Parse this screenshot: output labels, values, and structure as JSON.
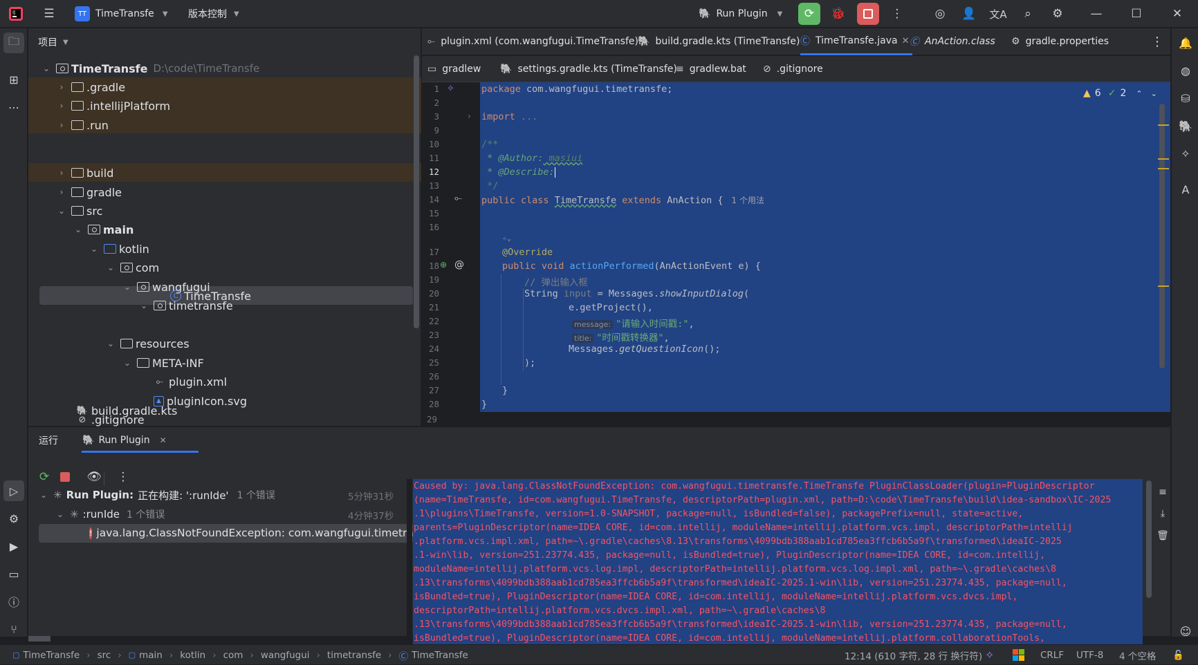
{
  "titlebar": {
    "project_badge": "TT",
    "project_name": "TimeTransfe",
    "vcs": "版本控制",
    "run_config": "Run Plugin"
  },
  "project_panel": {
    "title": "项目",
    "root_name": "TimeTransfe",
    "root_path": "D:\\code\\TimeTransfe",
    "items": [
      ".gradle",
      ".intellijPlatform",
      ".run",
      "build",
      "gradle",
      "src",
      "main",
      "kotlin",
      "com",
      "wangfugui",
      "timetransfe",
      "TimeTransfe",
      "resources",
      "META-INF",
      "plugin.xml",
      "pluginIcon.svg",
      ".gitignore",
      "build.gradle.kts"
    ]
  },
  "editor_tabs": [
    "plugin.xml (com.wangfugui.TimeTransfe)",
    "build.gradle.kts (TimeTransfe)",
    "TimeTransfe.java",
    "AnAction.class",
    "gradle.properties"
  ],
  "editor_tabs_row2": [
    "gradlew",
    "settings.gradle.kts (TimeTransfe)",
    "gradlew.bat",
    ".gitignore"
  ],
  "inspections": {
    "warnings": "6",
    "ok": "2"
  },
  "code": {
    "line_numbers": [
      "1",
      "2",
      "3",
      "9",
      "10",
      "11",
      "12",
      "13",
      "14",
      "15",
      "16",
      "17",
      "18",
      "19",
      "20",
      "21",
      "22",
      "23",
      "24",
      "25",
      "26",
      "27",
      "28",
      "29"
    ],
    "package_kw": "package",
    "package_name": " com.wangfugui.timetransfe;",
    "import_kw": "import",
    "import_rest": " ...",
    "doc_open": "/**",
    "doc_author_tag": " * @Author:",
    "doc_author_val": " masiui",
    "doc_describe_tag": " * @Describe:",
    "doc_close": " */",
    "class_public": "public",
    "class_kw": " class ",
    "class_name": "TimeTransfe",
    "class_extends": " extends ",
    "class_super": "AnAction {",
    "usages_hint": "1 个用法",
    "override": "@Override",
    "method_mod": "public void ",
    "method_name": "actionPerformed",
    "method_params": "(AnActionEvent e) {",
    "comment_line": "// 弹出输入框",
    "string_type": "String ",
    "var_input": "input",
    "assign": " = Messages.",
    "show_dialog": "showInputDialog",
    "open_paren": "(",
    "get_project": "e.getProject(),",
    "hint_message": "message:",
    "str_message": "\"请输入时间戳:\"",
    "hint_title": "title:",
    "str_title": "\"时间戳转换器\"",
    "messages_prefix": "Messages.",
    "question_icon": "getQuestionIcon",
    "close_call": "();",
    "close_paren": ");",
    "brace_inner": "}",
    "brace_outer": "}",
    "comma": ","
  },
  "run_panel": {
    "tab_run": "运行",
    "tab_run_plugin": "Run Plugin",
    "tree": [
      {
        "label": "Run Plugin:",
        "suffix": "正在构建: ':runIde'",
        "errors": "1 个错误",
        "time": "5分钟31秒"
      },
      {
        "label": ":runIde",
        "errors": "1 个错误",
        "time": "4分钟37秒"
      },
      {
        "label": "java.lang.ClassNotFoundException: com.wangfugui.timetran"
      }
    ],
    "console": [
      "Caused by: java.lang.ClassNotFoundException: com.wangfugui.timetransfe.TimeTransfe PluginClassLoader(plugin=PluginDescriptor",
      "(name=TimeTransfe, id=com.wangfugui.TimeTransfe, descriptorPath=plugin.xml, path=D:\\code\\TimeTransfe\\build\\idea-sandbox\\IC-2025",
      ".1\\plugins\\TimeTransfe, version=1.0-SNAPSHOT, package=null, isBundled=false), packagePrefix=null, state=active,",
      "parents=PluginDescriptor(name=IDEA CORE, id=com.intellij, moduleName=intellij.platform.vcs.impl, descriptorPath=intellij",
      ".platform.vcs.impl.xml, path=~\\.gradle\\caches\\8.13\\transforms\\4099bdb388aab1cd785ea3ffcb6b5a9f\\transformed\\ideaIC-2025",
      ".1-win\\lib, version=251.23774.435, package=null, isBundled=true), PluginDescriptor(name=IDEA CORE, id=com.intellij,",
      "moduleName=intellij.platform.vcs.log.impl, descriptorPath=intellij.platform.vcs.log.impl.xml, path=~\\.gradle\\caches\\8",
      ".13\\transforms\\4099bdb388aab1cd785ea3ffcb6b5a9f\\transformed\\ideaIC-2025.1-win\\lib, version=251.23774.435, package=null,",
      "isBundled=true), PluginDescriptor(name=IDEA CORE, id=com.intellij, moduleName=intellij.platform.vcs.dvcs.impl,",
      "descriptorPath=intellij.platform.vcs.dvcs.impl.xml, path=~\\.gradle\\caches\\8",
      ".13\\transforms\\4099bdb388aab1cd785ea3ffcb6b5a9f\\transformed\\ideaIC-2025.1-win\\lib, version=251.23774.435, package=null,",
      "isBundled=true), PluginDescriptor(name=IDEA CORE, id=com.intellij, moduleName=intellij.platform.collaborationTools,"
    ]
  },
  "statusbar": {
    "breadcrumb": [
      "TimeTransfe",
      "src",
      "main",
      "kotlin",
      "com",
      "wangfugui",
      "timetransfe",
      "TimeTransfe"
    ],
    "position": "12:14 (610 字符, 28 行 换行符)",
    "line_sep": "CRLF",
    "encoding": "UTF-8",
    "indent": "4 个空格"
  },
  "colors": {
    "accent": "#3574f0",
    "selection": "#214283",
    "error": "#f75464",
    "run_green": "#5fb865",
    "stop_red": "#db5c5c"
  }
}
